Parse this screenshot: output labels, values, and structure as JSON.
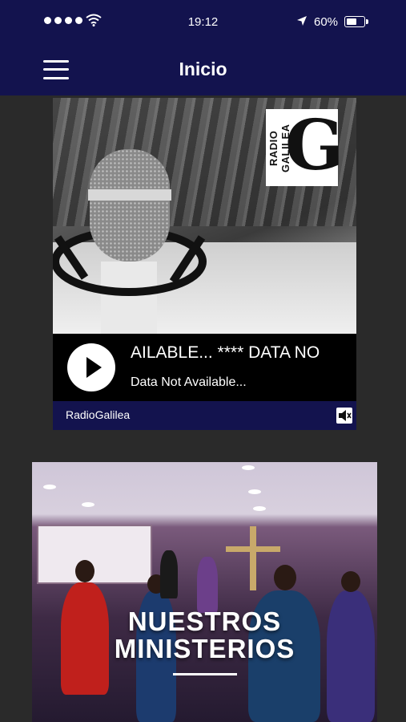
{
  "status_bar": {
    "time": "19:12",
    "battery": "60%",
    "battery_level": 0.6
  },
  "nav": {
    "title": "Inicio"
  },
  "player": {
    "logo_text": "RADIO GALILEA",
    "logo_letter": "G",
    "now_playing": "AILABLE... **** DATA NO",
    "subtitle": "Data Not Available...",
    "station": "RadioGalilea"
  },
  "ministries": {
    "title_line1": "NUESTROS",
    "title_line2": "MINISTERIOS"
  },
  "colors": {
    "header_bg": "#13134e",
    "page_bg": "#2a2a2a"
  }
}
